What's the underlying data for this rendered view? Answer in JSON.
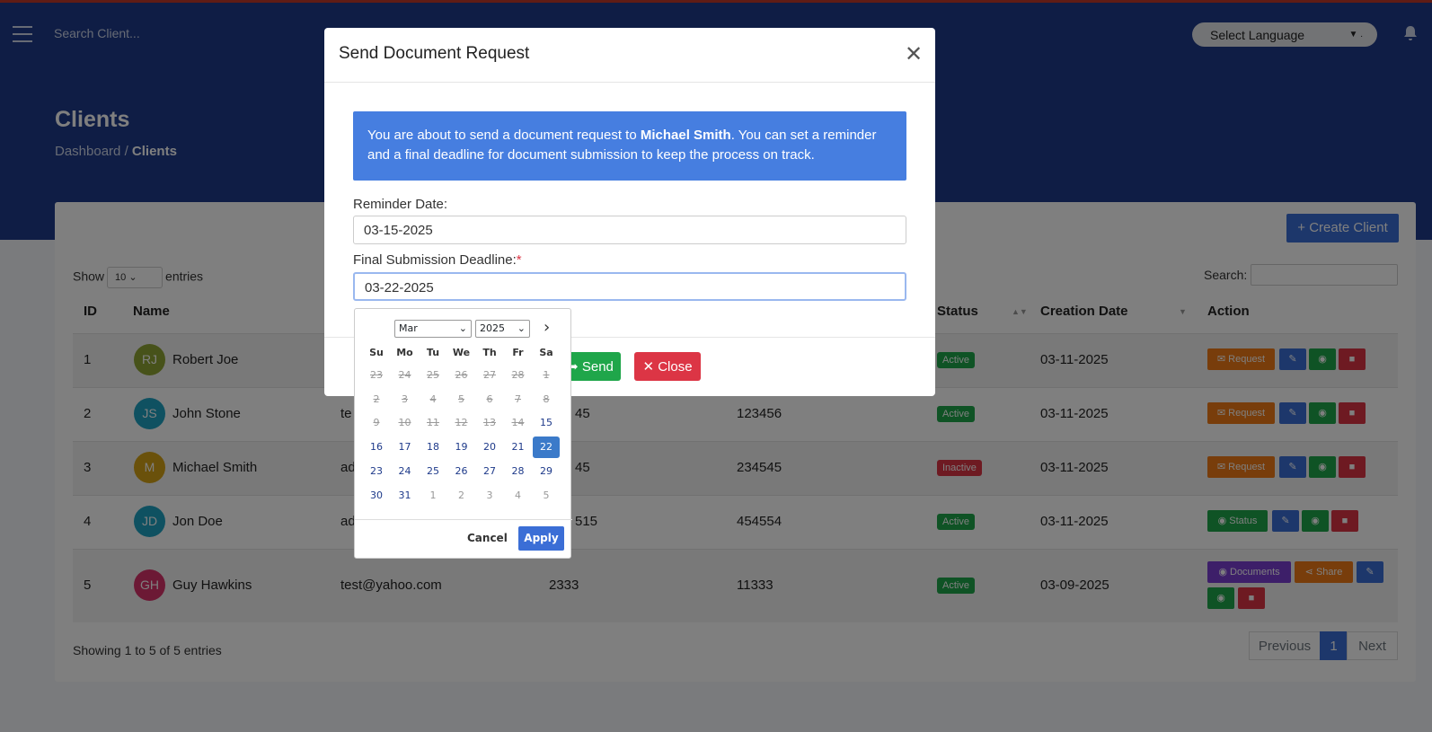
{
  "header": {
    "search_placeholder": "Search Client...",
    "language": "Select Language",
    "language_suffix": "."
  },
  "page": {
    "title": "Clients",
    "breadcrumb_home": "Dashboard",
    "breadcrumb_sep": "/",
    "breadcrumb_current": "Clients"
  },
  "toolbar": {
    "create_label": "+ Create Client",
    "show_label": "Show",
    "entries_value": "10",
    "entries_label": "entries",
    "search_label": "Search:"
  },
  "table": {
    "headers": [
      "ID",
      "Name",
      "Status",
      "Creation Date",
      "Action"
    ],
    "rows": [
      {
        "id": "1",
        "initials": "RJ",
        "avatar_color": "#8fa534",
        "name": "Robert Joe",
        "email": "",
        "phone": "",
        "code": "",
        "status": "Active",
        "date": "03-11-2025"
      },
      {
        "id": "2",
        "initials": "JS",
        "avatar_color": "#1fa3c2",
        "name": "John Stone",
        "email": "te",
        "phone": "45",
        "code": "123456",
        "status": "Active",
        "date": "03-11-2025"
      },
      {
        "id": "3",
        "initials": "M",
        "avatar_color": "#d5a216",
        "name": "Michael Smith",
        "email": "ad",
        "phone": "45",
        "code": "234545",
        "status": "Inactive",
        "date": "03-11-2025"
      },
      {
        "id": "4",
        "initials": "JD",
        "avatar_color": "#1fa3c2",
        "name": "Jon Doe",
        "email": "ad",
        "phone": "515",
        "code": "454554",
        "status": "Active",
        "date": "03-11-2025"
      },
      {
        "id": "5",
        "initials": "GH",
        "avatar_color": "#d8336a",
        "name": "Guy Hawkins",
        "email": "test@yahoo.com",
        "phone": "2333",
        "code": "11333",
        "status": "Active",
        "date": "03-09-2025"
      }
    ],
    "actions": {
      "request": "Request",
      "status": "Status",
      "documents": "Documents",
      "share": "Share"
    },
    "footer": "Showing 1 to 5 of 5 entries",
    "pagination": {
      "prev": "Previous",
      "page": "1",
      "next": "Next"
    }
  },
  "modal": {
    "title": "Send Document Request",
    "alert_before": "You are about to send a document request to ",
    "alert_name": "Michael Smith",
    "alert_after": ". You can set a reminder and a final deadline for document submission to keep the process on track.",
    "reminder_label": "Reminder Date:",
    "reminder_value": "03-15-2025",
    "deadline_label": "Final Submission Deadline:",
    "deadline_req": "*",
    "deadline_value": "03-22-2025",
    "send_label": "Send",
    "close_label": "Close"
  },
  "datepicker": {
    "month": "Mar",
    "year": "2025",
    "weekdays": [
      "Su",
      "Mo",
      "Tu",
      "We",
      "Th",
      "Fr",
      "Sa"
    ],
    "weeks": [
      [
        "23",
        "24",
        "25",
        "26",
        "27",
        "28",
        "1"
      ],
      [
        "2",
        "3",
        "4",
        "5",
        "6",
        "7",
        "8"
      ],
      [
        "9",
        "10",
        "11",
        "12",
        "13",
        "14",
        "15"
      ],
      [
        "16",
        "17",
        "18",
        "19",
        "20",
        "21",
        "22"
      ],
      [
        "23",
        "24",
        "25",
        "26",
        "27",
        "28",
        "29"
      ],
      [
        "30",
        "31",
        "1",
        "2",
        "3",
        "4",
        "5"
      ]
    ],
    "selected": "22",
    "cancel_label": "Cancel",
    "apply_label": "Apply"
  }
}
